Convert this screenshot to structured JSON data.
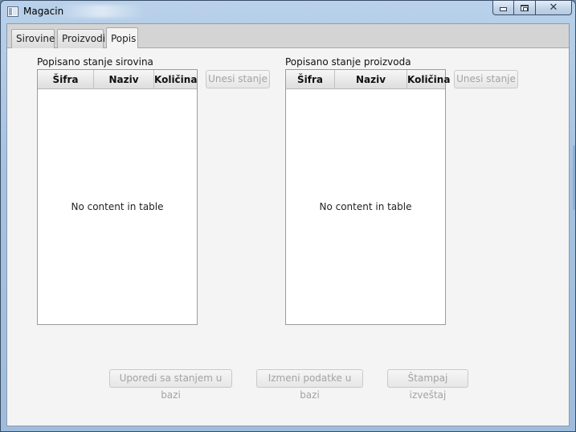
{
  "window": {
    "title": "Magacin"
  },
  "tabs": [
    {
      "label": "Sirovine",
      "selected": false
    },
    {
      "label": "Proizvodi",
      "selected": false
    },
    {
      "label": "Popis",
      "selected": true
    }
  ],
  "raw_section": {
    "label": "Popisano stanje sirovina",
    "columns": [
      "Šifra",
      "Naziv",
      "Količina"
    ],
    "empty_text": "No content in table",
    "button_label": "Unesi stanje"
  },
  "product_section": {
    "label": "Popisano stanje proizvoda",
    "columns": [
      "Šifra",
      "Naziv",
      "Količina"
    ],
    "empty_text": "No content in table",
    "button_label": "Unesi stanje"
  },
  "actions": {
    "compare_label": "Uporedi sa stanjem u bazi",
    "modify_label": "Izmeni podatke u bazi",
    "print_label": "Štampaj izveštaj"
  },
  "icons": {
    "app": "window-app-icon",
    "minimize": "minimize-icon",
    "maximize": "maximize-icon",
    "close": "close-icon"
  },
  "colors": {
    "titlebar": "#a6c2e0",
    "client_bg": "#f4f4f4",
    "disabled_text": "#a3a3a3"
  }
}
